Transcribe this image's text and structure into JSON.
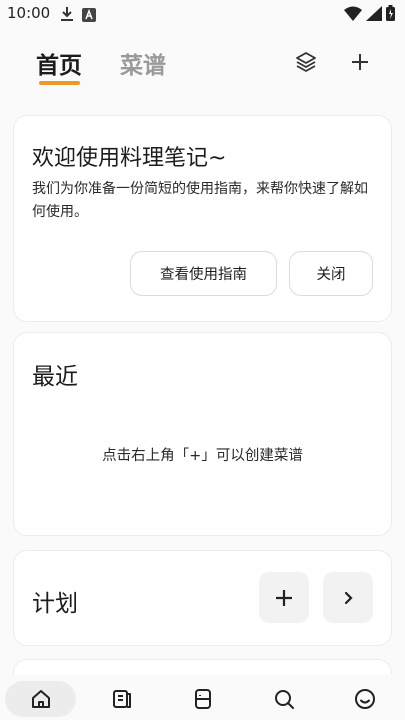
{
  "status_bar": {
    "time": "10:00",
    "left_icons": [
      "download-icon",
      "a-letter-notification-icon"
    ],
    "right_icons": [
      "wifi-icon",
      "signal-icon",
      "battery-icon"
    ]
  },
  "topbar": {
    "tabs": [
      {
        "label": "首页",
        "active": true
      },
      {
        "label": "菜谱",
        "active": false
      }
    ],
    "accent_color": "#ee9a24",
    "actions": [
      "layers-icon",
      "plus-icon"
    ]
  },
  "welcome": {
    "title": "欢迎使用料理笔记~",
    "description": "我们为你准备一份简短的使用指南，来帮你快速了解如何使用。",
    "guide_button": "查看使用指南",
    "close_button": "关闭"
  },
  "recent": {
    "title": "最近",
    "empty_text": "点击右上角「+」可以创建菜谱"
  },
  "plan": {
    "title": "计划",
    "actions": [
      "plus-icon",
      "chevron-right-icon"
    ]
  },
  "bottom_nav": {
    "items": [
      "home-icon",
      "recipe-book-icon",
      "pantry-icon",
      "search-icon",
      "smiley-icon"
    ],
    "active": "home-icon"
  }
}
